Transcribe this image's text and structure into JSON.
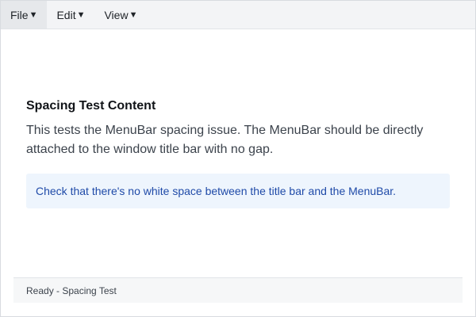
{
  "menubar": {
    "items": [
      {
        "label": "File",
        "caret": "▼"
      },
      {
        "label": "Edit",
        "caret": "▼"
      },
      {
        "label": "View",
        "caret": "▼"
      }
    ]
  },
  "main": {
    "heading": "Spacing Test Content",
    "description": "This tests the MenuBar spacing issue. The MenuBar should be directly attached to the window title bar with no gap.",
    "info": "Check that there's no white space between the title bar and the MenuBar."
  },
  "statusbar": {
    "text": "Ready - Spacing Test"
  },
  "colors": {
    "menubar_bg": "#f3f4f6",
    "info_bg": "#eef5fd",
    "info_text": "#1f4aa8"
  }
}
